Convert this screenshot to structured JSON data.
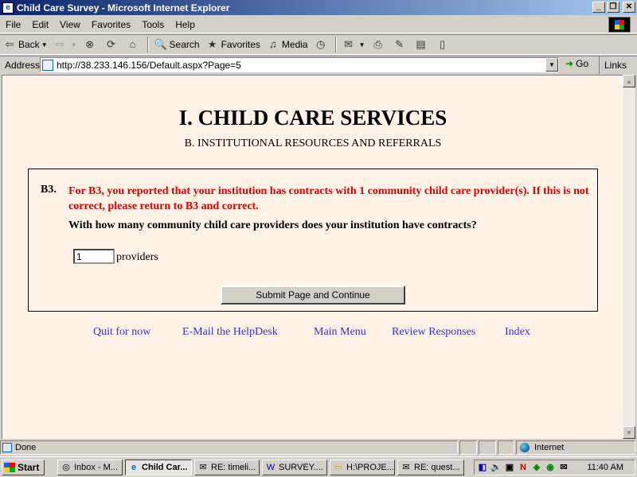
{
  "window": {
    "title": "Child Care Survey - Microsoft Internet Explorer"
  },
  "menu": [
    "File",
    "Edit",
    "View",
    "Favorites",
    "Tools",
    "Help"
  ],
  "toolbar": {
    "back": "Back",
    "search": "Search",
    "favorites": "Favorites",
    "media": "Media"
  },
  "address": {
    "label": "Address",
    "url": "http://38.233.146.156/Default.aspx?Page=5",
    "go": "Go",
    "links": "Links"
  },
  "page": {
    "heading": "I. CHILD CARE SERVICES",
    "subheading": "B. INSTITUTIONAL RESOURCES AND REFERRALS",
    "question": {
      "number": "B3.",
      "warning": "For B3, you reported that your institution has contracts with 1 community child care provider(s). If this is not correct, please return to B3 and correct.",
      "text": "With how many community child care providers does your institution have contracts?",
      "value": "1",
      "unit": "providers"
    },
    "submit_label": "Submit Page and Continue",
    "nav_links": [
      "Quit for now",
      "E-Mail the HelpDesk",
      "Main Menu",
      "Review Responses",
      "Index"
    ],
    "link_color": "#3333cc",
    "warning_color": "#e00000",
    "background": "#fff2e6"
  },
  "status": {
    "text": "Done",
    "zone": "Internet"
  },
  "taskbar": {
    "start": "Start",
    "buttons": [
      "Inbox - M...",
      "Child Car...",
      "RE: timeli...",
      "SURVEY....",
      "H:\\PROJE...",
      "RE: quest..."
    ],
    "clock": "11:40 AM"
  }
}
